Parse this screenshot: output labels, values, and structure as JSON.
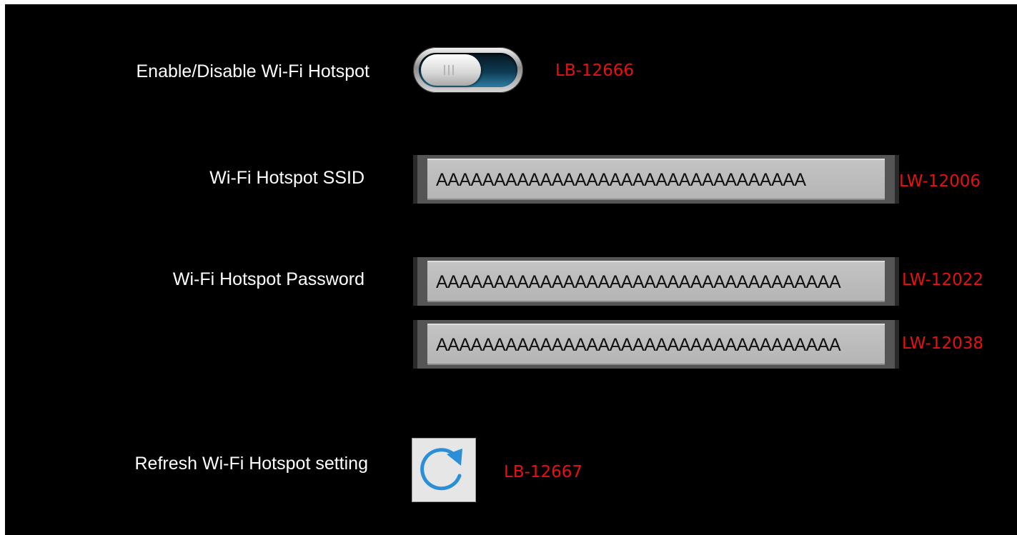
{
  "hotspot_toggle": {
    "label": "Enable/Disable Wi-Fi Hotspot",
    "address": "LB-12666",
    "icon": "toggle-switch-icon",
    "state": "off"
  },
  "ssid": {
    "label": "Wi-Fi Hotspot SSID",
    "value": "AAAAAAAAAAAAAAAAAAAAAAAAAAAAAAAA",
    "address": "LW-12006"
  },
  "password": {
    "label": "Wi-Fi Hotspot Password",
    "value_1": "AAAAAAAAAAAAAAAAAAAAAAAAAAAAAAAAAAA",
    "address_1": "LW-12022",
    "value_2": "AAAAAAAAAAAAAAAAAAAAAAAAAAAAAAAAAAA",
    "address_2": "LW-12038"
  },
  "refresh": {
    "label": "Refresh Wi-Fi Hotspot setting",
    "address": "LB-12667",
    "icon": "refresh-icon"
  },
  "colors": {
    "background": "#000000",
    "address_text": "#e81010",
    "refresh_icon": "#2a8fd6"
  }
}
